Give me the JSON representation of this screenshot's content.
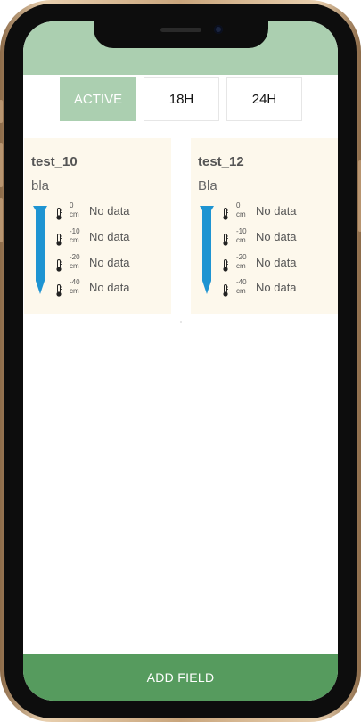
{
  "tabs": [
    {
      "label": "ACTIVE",
      "active": true
    },
    {
      "label": "18H",
      "active": false
    },
    {
      "label": "24H",
      "active": false
    }
  ],
  "fields": [
    {
      "name": "test_10",
      "description": "bla",
      "readings": [
        {
          "depth": "0",
          "unit": "cm",
          "value": "No data"
        },
        {
          "depth": "-10",
          "unit": "cm",
          "value": "No data"
        },
        {
          "depth": "-20",
          "unit": "cm",
          "value": "No data"
        },
        {
          "depth": "-40",
          "unit": "cm",
          "value": "No data"
        }
      ]
    },
    {
      "name": "test_12",
      "description": "Bla",
      "readings": [
        {
          "depth": "0",
          "unit": "cm",
          "value": "No data"
        },
        {
          "depth": "-10",
          "unit": "cm",
          "value": "No data"
        },
        {
          "depth": "-20",
          "unit": "cm",
          "value": "No data"
        },
        {
          "depth": "-40",
          "unit": "cm",
          "value": "No data"
        }
      ]
    }
  ],
  "add_button": {
    "label": "ADD FIELD"
  },
  "colors": {
    "header": "#abcfb0",
    "tab_active": "#abcfb0",
    "card_bg": "#fdf8ec",
    "probe": "#1e94d2",
    "add_button": "#569b5e"
  },
  "icons": {
    "probe": "sensor-probe-icon",
    "reading": "thermometer-icon"
  }
}
